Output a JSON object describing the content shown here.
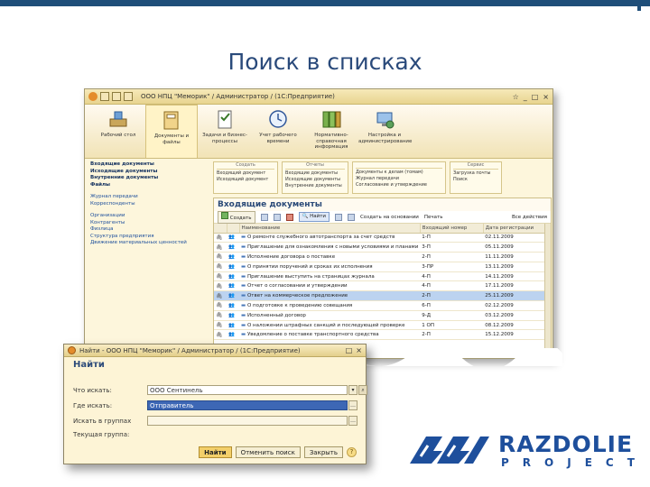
{
  "slide": {
    "title": "Поиск в списках"
  },
  "main_window": {
    "title": "ООО НПЦ \"Меморик\" / Администратор / (1С:Предприятие)",
    "sections": [
      {
        "label": "Рабочий стол"
      },
      {
        "label": "Документы и файлы"
      },
      {
        "label": "Задачи и бизнес-процессы"
      },
      {
        "label": "Учет рабочего времени"
      },
      {
        "label": "Нормативно-справочная информация"
      },
      {
        "label": "Настройка и администрирование"
      }
    ],
    "nav": {
      "group1": [
        "Входящие документы",
        "Исходящие документы",
        "Внутренние документы",
        "Файлы"
      ],
      "group2": [
        "Журнал передачи",
        "Корреспонденты"
      ],
      "group3": [
        "Организации",
        "Контрагенты",
        "Физлица",
        "Структура предприятия",
        "Движение материальных ценностей"
      ]
    },
    "actions": [
      {
        "head": "Создать",
        "items": [
          "Входящий документ",
          "Исходящий документ"
        ]
      },
      {
        "head": "Отчеты",
        "items": [
          "Входящие документы",
          "Исходящие документы",
          "Внутренние документы"
        ]
      },
      {
        "head": "",
        "items": [
          "Документы к делам (томам)",
          "Журнал передачи",
          "Согласование и утверждение"
        ]
      },
      {
        "head": "Сервис",
        "items": [
          "Загрузка почты",
          "Поиск"
        ]
      }
    ],
    "list": {
      "title": "Входящие документы",
      "toolbar": {
        "create": "Создать",
        "find": "Найти",
        "create_by_basis": "Создать на основании",
        "print": "Печать",
        "all_actions": "Все действия"
      },
      "columns": [
        "",
        "",
        "Наименование",
        "Входящий номер",
        "Дата регистрации"
      ],
      "rows": [
        {
          "name": "О ремонте служебного автотранспорта за счет средств",
          "number": "1-П",
          "date": "02.11.2009"
        },
        {
          "name": "Приглашение для ознакомления с новыми условиями и планами",
          "number": "3-П",
          "date": "05.11.2009"
        },
        {
          "name": "Исполнение договора о поставке",
          "number": "2-П",
          "date": "11.11.2009"
        },
        {
          "name": "О принятии поручений и сроках их исполнения",
          "number": "3-ПР",
          "date": "13.11.2009"
        },
        {
          "name": "Приглашение выступить на страницах журнала",
          "number": "4-П",
          "date": "14.11.2009"
        },
        {
          "name": "Отчет о согласовании и утверждении",
          "number": "4-П",
          "date": "17.11.2009"
        },
        {
          "name": "Ответ на коммерческое предложение",
          "number": "2-П",
          "date": "25.11.2009"
        },
        {
          "name": "О подготовке к проведению совещания",
          "number": "6-П",
          "date": "02.12.2009"
        },
        {
          "name": "Исполненный договор",
          "number": "9-Д",
          "date": "03.12.2009"
        },
        {
          "name": "О наложении штрафных санкций и последующей проверке",
          "number": "1 ОП",
          "date": "08.12.2009"
        },
        {
          "name": "Уведомление о поставке транспортного средства",
          "number": "2-П",
          "date": "15.12.2009"
        }
      ]
    }
  },
  "find_dialog": {
    "title": "Найти - ООО НПЦ \"Меморик\" / Администратор / (1С:Предприятие)",
    "heading": "Найти",
    "fields": [
      {
        "label": "Что искать:",
        "value": "ООО Сентинель"
      },
      {
        "label": "Где искать:",
        "value": "Отправитель"
      },
      {
        "label": "Искать в группах",
        "value": ""
      },
      {
        "label": "Текущая группа:",
        "value": ""
      }
    ],
    "buttons": {
      "find": "Найти",
      "cancel": "Отменить поиск",
      "close": "Закрыть",
      "help": "?"
    }
  },
  "logo": {
    "line1": "RAZDOLIE",
    "line2": "PROJECT"
  },
  "colors": {
    "brand_blue": "#1e4f9c",
    "title_blue": "#2a4a7b",
    "selection_blue": "#3d67b5",
    "window_cream": "#fdf6dc"
  }
}
